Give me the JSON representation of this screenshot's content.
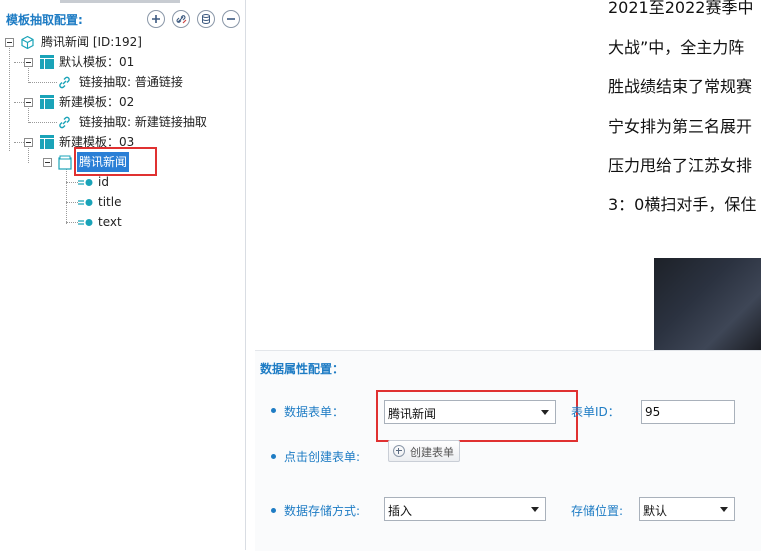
{
  "left_panel": {
    "title": "模板抽取配置:",
    "toolbar_icons": [
      "add-icon",
      "link-edit-icon",
      "database-icon",
      "remove-icon"
    ],
    "tree": {
      "root": "腾讯新闻 [ID:192]",
      "template1": "默认模板：01",
      "template1_link": "链接抽取: 普通链接",
      "template2": "新建模板：02",
      "template2_link": "链接抽取: 新建链接抽取",
      "template3": "新建模板：03",
      "table_node": "腾讯新闻",
      "fields": [
        "id",
        "title",
        "text"
      ]
    }
  },
  "article": {
    "lines": [
      "2021至2022赛季中",
      "大战”中，全主力阵",
      "胜战绩结束了常规赛",
      "宁女排为第三名展开",
      "压力甩给了江苏女排",
      "3：0横扫对手，保住"
    ]
  },
  "config": {
    "title": "数据属性配置：",
    "data_table_label": "数据表单：",
    "data_table_value": "腾讯新闻",
    "table_id_label": "表单ID：",
    "table_id_value": "95",
    "create_table_label": "点击创建表单:",
    "create_table_button": "创建表单",
    "storage_mode_label": "数据存储方式:",
    "storage_mode_value": "插入",
    "storage_location_label": "存储位置:",
    "storage_location_value": "默认"
  },
  "colors": {
    "accent": "#1e7cc4",
    "selection": "#2a7fd6",
    "highlight_box": "#e03131",
    "template_icon": "#1aa3b8"
  }
}
